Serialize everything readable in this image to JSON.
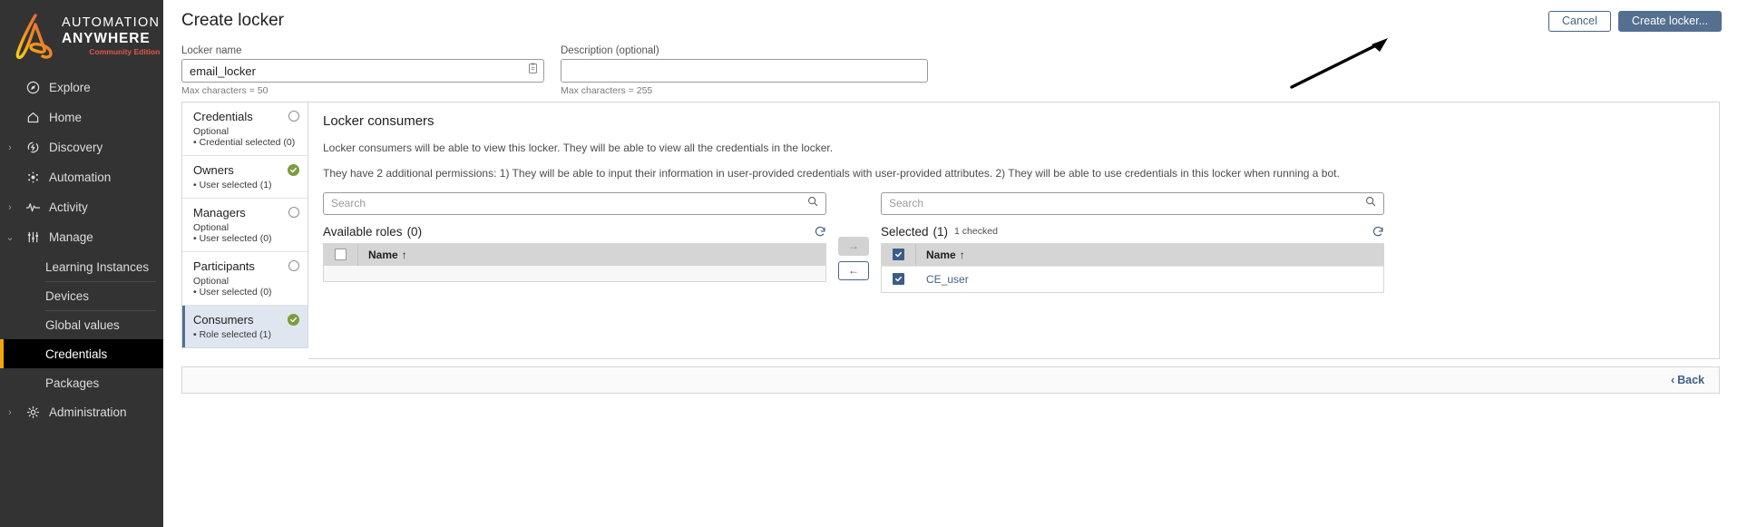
{
  "brand": {
    "line1": "AUTOMATION",
    "line2": "ANYWHERE",
    "line3": "Community Edition",
    "logo_color_top": "#f5a623",
    "logo_color_bottom": "#e2574c"
  },
  "sidebar": {
    "items": [
      {
        "label": "Explore",
        "icon": "compass-icon",
        "caret": ""
      },
      {
        "label": "Home",
        "icon": "home-icon",
        "caret": ""
      },
      {
        "label": "Discovery",
        "icon": "discovery-icon",
        "caret": "›"
      },
      {
        "label": "Automation",
        "icon": "automation-icon",
        "caret": ""
      },
      {
        "label": "Activity",
        "icon": "activity-icon",
        "caret": "›"
      },
      {
        "label": "Manage",
        "icon": "sliders-icon",
        "caret": "⌄"
      }
    ],
    "sub_items": [
      {
        "label": "Learning Instances",
        "active": false
      },
      {
        "label": "Devices",
        "active": false
      },
      {
        "label": "Global values",
        "active": false
      },
      {
        "label": "Credentials",
        "active": true
      },
      {
        "label": "Packages",
        "active": false
      }
    ],
    "admin": {
      "label": "Administration",
      "icon": "gear-icon",
      "caret": "›"
    },
    "active_accent": "#f2a60c"
  },
  "header": {
    "title": "Create locker",
    "cancel_label": "Cancel",
    "create_label": "Create locker...",
    "primary_color": "#546f8f"
  },
  "form": {
    "locker_name_label": "Locker name",
    "locker_name_value": "email_locker",
    "locker_name_hint": "Max characters = 50",
    "description_label": "Description (optional)",
    "description_value": "",
    "description_placeholder": "",
    "description_hint": "Max characters = 255"
  },
  "steps": [
    {
      "title": "Credentials",
      "optional": "Optional",
      "selected": "• Credential selected (0)",
      "state": "empty",
      "active": false
    },
    {
      "title": "Owners",
      "optional": "",
      "selected": "• User selected (1)",
      "state": "check",
      "active": false
    },
    {
      "title": "Managers",
      "optional": "Optional",
      "selected": "• User selected (0)",
      "state": "empty",
      "active": false
    },
    {
      "title": "Participants",
      "optional": "Optional",
      "selected": "• User selected (0)",
      "state": "empty",
      "active": false
    },
    {
      "title": "Consumers",
      "optional": "",
      "selected": "• Role selected (1)",
      "state": "check",
      "active": true
    }
  ],
  "panel": {
    "heading": "Locker consumers",
    "paragraph1": "Locker consumers will be able to view this locker. They will be able to view all the credentials in the locker.",
    "paragraph2": "They have 2 additional permissions: 1) They will be able to input their information in user-provided credentials with user-provided attributes. 2) They will be able to use credentials in this locker when running a bot."
  },
  "transfer": {
    "left": {
      "search_placeholder": "Search",
      "title": "Available roles",
      "count": "(0)",
      "column_name": "Name",
      "sort_glyph": "↑",
      "rows": []
    },
    "right": {
      "search_placeholder": "Search",
      "title": "Selected",
      "count": "(1)",
      "checked_note": "1 checked",
      "column_name": "Name",
      "sort_glyph": "↑",
      "rows": [
        {
          "name": "CE_user",
          "checked": true
        }
      ],
      "header_checked": true
    },
    "move_right_label": "→",
    "move_left_label": "←",
    "refresh_icon": "refresh-icon",
    "search_icon": "search-icon"
  },
  "footer": {
    "back_label": "Back",
    "back_chevron": "‹"
  }
}
